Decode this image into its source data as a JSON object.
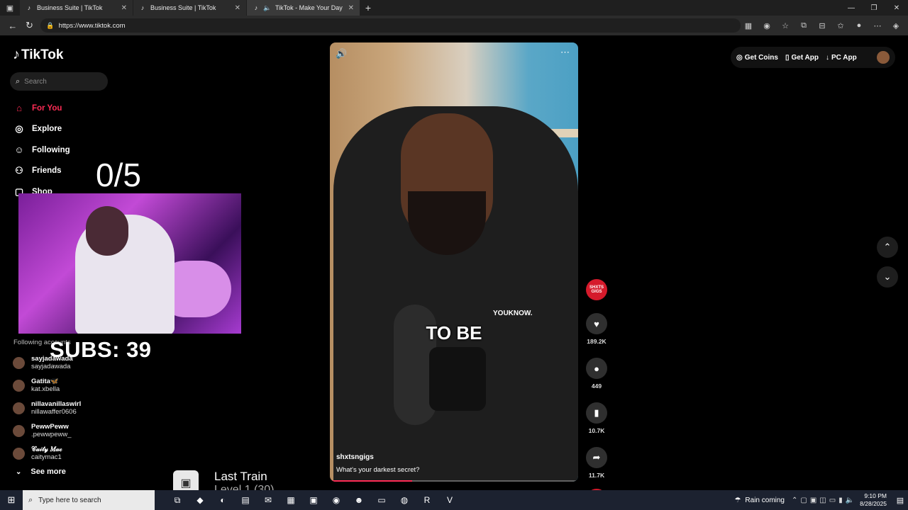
{
  "browser": {
    "tabs": [
      {
        "label": "Business Suite | TikTok",
        "active": false
      },
      {
        "label": "Business Suite | TikTok",
        "active": false
      },
      {
        "label": "TikTok - Make Your Day",
        "active": true
      }
    ],
    "url": "https://www.tiktok.com"
  },
  "sidebar": {
    "logo": "TikTok",
    "search_placeholder": "Search",
    "nav": [
      {
        "label": "For You",
        "icon": "home-icon",
        "active": true
      },
      {
        "label": "Explore",
        "icon": "compass-icon",
        "active": false
      },
      {
        "label": "Following",
        "icon": "user-follow-icon",
        "active": false
      },
      {
        "label": "Friends",
        "icon": "friends-icon",
        "active": false
      },
      {
        "label": "Shop",
        "icon": "shop-icon",
        "active": false
      }
    ],
    "following_header": "Following accounts",
    "accounts": [
      {
        "name": "sayjadawada",
        "handle": "sayjadawada"
      },
      {
        "name": "Gatita🦋",
        "handle": "kat.xbella"
      },
      {
        "name": "nillavanillaswirl",
        "handle": "nillawaffer0606"
      },
      {
        "name": "PewwPeww",
        "handle": ".pewwpeww_"
      },
      {
        "name": "𝒞𝒶𝒾𝓉𝓎 𝑀𝒶𝒸",
        "handle": "caitymac1"
      }
    ],
    "see_more": "See more"
  },
  "overlay": {
    "counter": "0/5",
    "subs": "SUBS: 39",
    "song_title": "Last Train",
    "song_sub": "Level 1 (30)"
  },
  "video": {
    "caption": "TO BE",
    "shirt_text": "YOUKNOW.",
    "author": "shxtsngigs",
    "description": "What's your darkest secret?",
    "progress": 0.33
  },
  "actions": {
    "likes": "189.2K",
    "comments": "449",
    "saves": "10.7K",
    "shares": "11.7K",
    "avatar_text": "SHXTS GIGS"
  },
  "topbar": {
    "get_coins": "Get Coins",
    "get_app": "Get App",
    "pc_app": "PC App"
  },
  "taskbar": {
    "search_placeholder": "Type here to search",
    "weather": "Rain coming",
    "time": "9:10 PM",
    "date": "8/28/2025"
  },
  "colors": {
    "accent": "#fe2c55",
    "background": "#000000"
  }
}
